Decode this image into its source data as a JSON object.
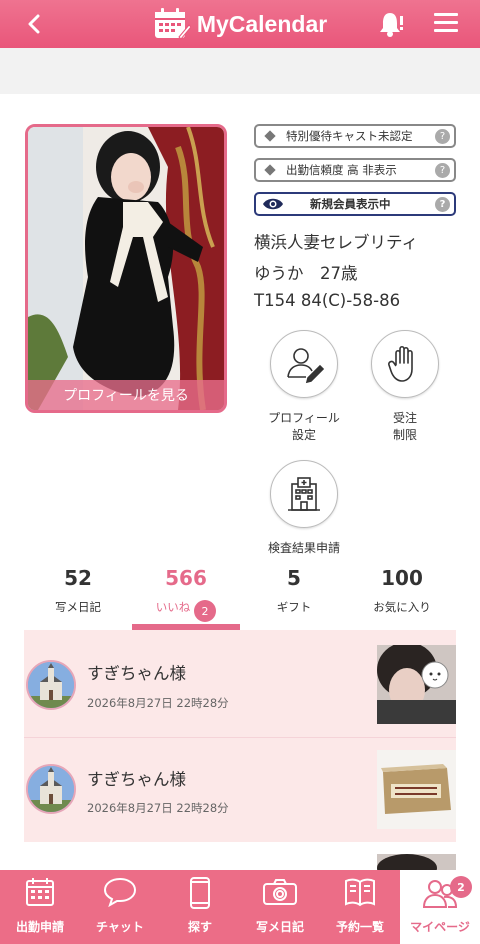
{
  "header": {
    "title": "MyCalendar"
  },
  "profile": {
    "view_profile": "プロフィールを見る",
    "badges": [
      "特別優待キャスト未認定",
      "出勤信頼度 高 非表示",
      "新規会員表示中"
    ],
    "shop": "横浜人妻セレブリティ",
    "name_age": "ゆうか　27歳",
    "measurements": "T154 84(C)-58-86"
  },
  "actions": {
    "profile_settings": [
      "プロフィール",
      "設定"
    ],
    "order_limit": [
      "受注",
      "制限"
    ],
    "inspection": "検査結果申請"
  },
  "stats": [
    {
      "num": "52",
      "label": "写メ日記"
    },
    {
      "num": "566",
      "label": "いいね",
      "badge": "2"
    },
    {
      "num": "5",
      "label": "ギフト"
    },
    {
      "num": "100",
      "label": "お気に入り"
    }
  ],
  "feed": [
    {
      "name": "すぎちゃん様",
      "date": "2026年8月27日 22時28分"
    },
    {
      "name": "すぎちゃん様",
      "date": "2026年8月27日 22時28分"
    }
  ],
  "bottom_nav": [
    {
      "label": "出勤申請",
      "icon": "calendar-icon"
    },
    {
      "label": "チャット",
      "icon": "chat-bubble-icon"
    },
    {
      "label": "探す",
      "icon": "smartphone-icon"
    },
    {
      "label": "写メ日記",
      "icon": "camera-icon"
    },
    {
      "label": "予約一覧",
      "icon": "book-icon"
    },
    {
      "label": "マイページ",
      "icon": "users-icon",
      "badge": "2"
    }
  ],
  "colors": {
    "accent": "#e56a8a",
    "header": "#ec6d87",
    "feed_bg": "#fce8e8"
  }
}
